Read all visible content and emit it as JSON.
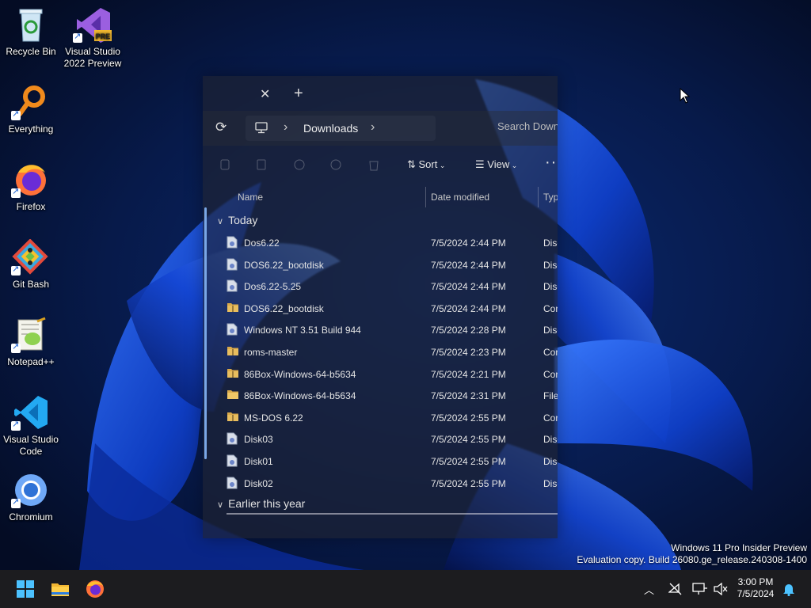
{
  "desktop": {
    "icons": [
      {
        "label": "Recycle Bin",
        "icon": "recycle-bin-icon"
      },
      {
        "label": "Visual Studio 2022 Preview",
        "icon": "visual-studio-icon",
        "badge": "PRE"
      },
      {
        "label": "Everything",
        "icon": "everything-icon"
      },
      {
        "label": "Firefox",
        "icon": "firefox-icon"
      },
      {
        "label": "Git Bash",
        "icon": "git-bash-icon"
      },
      {
        "label": "Notepad++",
        "icon": "notepadpp-icon"
      },
      {
        "label": "Visual Studio Code",
        "icon": "vscode-icon"
      },
      {
        "label": "Chromium",
        "icon": "chromium-icon"
      }
    ],
    "watermark": {
      "line1": "Windows 11 Pro Insider Preview",
      "line2": "Evaluation copy. Build 26080.ge_release.240308-1400"
    }
  },
  "explorer": {
    "tab": {
      "close": "✕",
      "new": "+"
    },
    "address": {
      "refresh": "⟳",
      "crumbs": [
        "Downloads"
      ],
      "separator": "›"
    },
    "search_placeholder": "Search Downloads",
    "toolbar": {
      "sort": "Sort",
      "view": "View",
      "more": "···"
    },
    "columns": {
      "name": "Name",
      "date": "Date modified",
      "type": "Type"
    },
    "groups": [
      {
        "label": "Today",
        "expanded": true
      },
      {
        "label": "Earlier this year",
        "expanded": true
      }
    ],
    "files": [
      {
        "name": "Dos6.22",
        "date": "7/5/2024 2:44 PM",
        "type": "Disc",
        "kind": "disc"
      },
      {
        "name": "DOS6.22_bootdisk",
        "date": "7/5/2024 2:44 PM",
        "type": "Disc",
        "kind": "disc"
      },
      {
        "name": "Dos6.22-5.25",
        "date": "7/5/2024 2:44 PM",
        "type": "Disc",
        "kind": "disc"
      },
      {
        "name": "DOS6.22_bootdisk",
        "date": "7/5/2024 2:44 PM",
        "type": "Cor",
        "kind": "zip"
      },
      {
        "name": "Windows NT  3.51 Build 944",
        "date": "7/5/2024 2:28 PM",
        "type": "Disc",
        "kind": "disc"
      },
      {
        "name": "roms-master",
        "date": "7/5/2024 2:23 PM",
        "type": "Cor",
        "kind": "zip"
      },
      {
        "name": "86Box-Windows-64-b5634",
        "date": "7/5/2024 2:21 PM",
        "type": "Cor",
        "kind": "zip"
      },
      {
        "name": "86Box-Windows-64-b5634",
        "date": "7/5/2024 2:31 PM",
        "type": "File",
        "kind": "folder"
      },
      {
        "name": "MS-DOS 6.22",
        "date": "7/5/2024 2:55 PM",
        "type": "Cor",
        "kind": "zip"
      },
      {
        "name": "Disk03",
        "date": "7/5/2024 2:55 PM",
        "type": "Disc",
        "kind": "disc"
      },
      {
        "name": "Disk01",
        "date": "7/5/2024 2:55 PM",
        "type": "Disc",
        "kind": "disc"
      },
      {
        "name": "Disk02",
        "date": "7/5/2024 2:55 PM",
        "type": "Disc",
        "kind": "disc"
      }
    ]
  },
  "taskbar": {
    "pinned": [
      "start-icon",
      "file-explorer-icon",
      "firefox-icon"
    ],
    "tray": {
      "chevron": "^",
      "time": "3:00 PM",
      "date": "7/5/2024"
    }
  },
  "colors": {
    "accent": "#1a5fd0",
    "taskbar": "#1c1c1f",
    "wallpaper": "#071433"
  }
}
